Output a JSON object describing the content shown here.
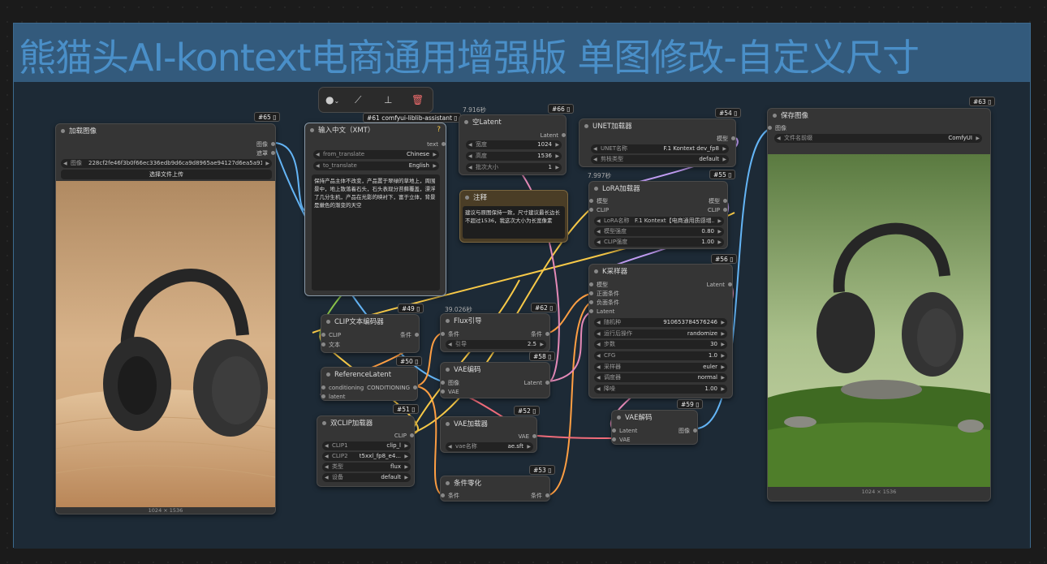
{
  "group": {
    "title": "熊猫头AI-kontext电商通用增强版  单图修改-自定义尺寸"
  },
  "toolbar": {
    "color_icon": "color-circle",
    "bypass_icon": "bypass-wand",
    "pin_icon": "pin",
    "delete_icon": "trash"
  },
  "nodes": {
    "load_image": {
      "id": "#65",
      "title": "加载图像",
      "out1": "图像",
      "out2": "遮罩",
      "image_label": "图像",
      "image_value": "228cf2fe46f3b0f66ec336edb9d6ca9d8965ae94127d6ea5a919e6...",
      "upload": "选择文件上传",
      "caption": "1024 × 1536"
    },
    "translate": {
      "id": "#61 comfyui-liblib-assistant",
      "title": "输入中文（XMT）",
      "help": "?",
      "out": "text",
      "from_label": "from_translate",
      "from_value": "Chinese",
      "to_label": "to_translate",
      "to_value": "English",
      "text": "保持产品主体不改变，产品置于翠绿的草地上，周围景中，地上散落着石头，石头表现分苔藓覆盖，漂浮了几分生机，产品在光影的映衬下，富于立体，背景是嫩色的渐变的天空"
    },
    "empty_latent": {
      "id": "#66",
      "timing": "7.916秒",
      "title": "空Latent",
      "out": "Latent",
      "w_label": "宽度",
      "w_value": "1024",
      "h_label": "高度",
      "h_value": "1536",
      "b_label": "批次大小",
      "b_value": "1"
    },
    "note": {
      "title": "注释",
      "text": "建议与原图保持一致，尺寸建议最长边长不超过1536，我这次大小为长宽像素"
    },
    "unet": {
      "id": "#54",
      "title": "UNET加载器",
      "out": "模型",
      "name_label": "UNET名称",
      "name_value": "F.1 Kontext dev_fp8",
      "type_label": "剪枝类型",
      "type_value": "default"
    },
    "lora": {
      "id": "#55",
      "timing": "7.997秒",
      "title": "LoRA加载器",
      "in1": "模型",
      "in2": "CLIP",
      "out1": "模型",
      "out2": "CLIP",
      "name_label": "LoRA名称",
      "name_value": "F.1 Kontext【电商通用质感增...",
      "m_label": "模型强度",
      "m_value": "0.80",
      "c_label": "CLIP强度",
      "c_value": "1.00"
    },
    "ksampler": {
      "id": "#56",
      "title": "K采样器",
      "in1": "模型",
      "in2": "正面条件",
      "in3": "负面条件",
      "in4": "Latent",
      "out": "Latent",
      "seed_label": "随机种",
      "seed_value": "910653784576246",
      "ctrl_label": "运行后操作",
      "ctrl_value": "randomize",
      "steps_label": "步数",
      "steps_value": "30",
      "cfg_label": "CFG",
      "cfg_value": "1.0",
      "sampler_label": "采样器",
      "sampler_value": "euler",
      "sched_label": "调度器",
      "sched_value": "normal",
      "denoise_label": "降噪",
      "denoise_value": "1.00"
    },
    "save": {
      "id": "#63",
      "title": "保存图像",
      "in": "图像",
      "prefix_label": "文件名前缀",
      "prefix_value": "ComfyUI",
      "caption": "1024 × 1536"
    },
    "clip_text": {
      "id": "#49",
      "title": "CLIP文本编码器",
      "in1": "CLIP",
      "in2": "文本",
      "out": "条件"
    },
    "ref_latent": {
      "id": "#50",
      "title": "ReferenceLatent",
      "in1": "conditioning",
      "in2": "latent",
      "out": "CONDITIONING"
    },
    "dual_clip": {
      "id": "#51",
      "title": "双CLIP加载器",
      "out": "CLIP",
      "c1_label": "CLIP1",
      "c1_value": "clip_l",
      "c2_label": "CLIP2",
      "c2_value": "t5xxl_fp8_e4...",
      "t_label": "类型",
      "t_value": "flux",
      "d_label": "设备",
      "d_value": "default"
    },
    "flux_guide": {
      "id": "#62",
      "timing": "39.026秒",
      "title": "Flux引导",
      "in": "条件",
      "out": "条件",
      "g_label": "引导",
      "g_value": "2.5"
    },
    "vae_encode": {
      "id": "#58",
      "title": "VAE编码",
      "in1": "图像",
      "in2": "VAE",
      "out": "Latent"
    },
    "vae_loader": {
      "id": "#52",
      "title": "VAE加载器",
      "out": "VAE",
      "n_label": "vae名称",
      "n_value": "ae.sft"
    },
    "cond_zero": {
      "id": "#53",
      "title": "条件零化",
      "in": "条件",
      "out": "条件"
    },
    "vae_decode": {
      "id": "#59",
      "title": "VAE解码",
      "in1": "Latent",
      "in2": "VAE",
      "out": "图像"
    }
  }
}
